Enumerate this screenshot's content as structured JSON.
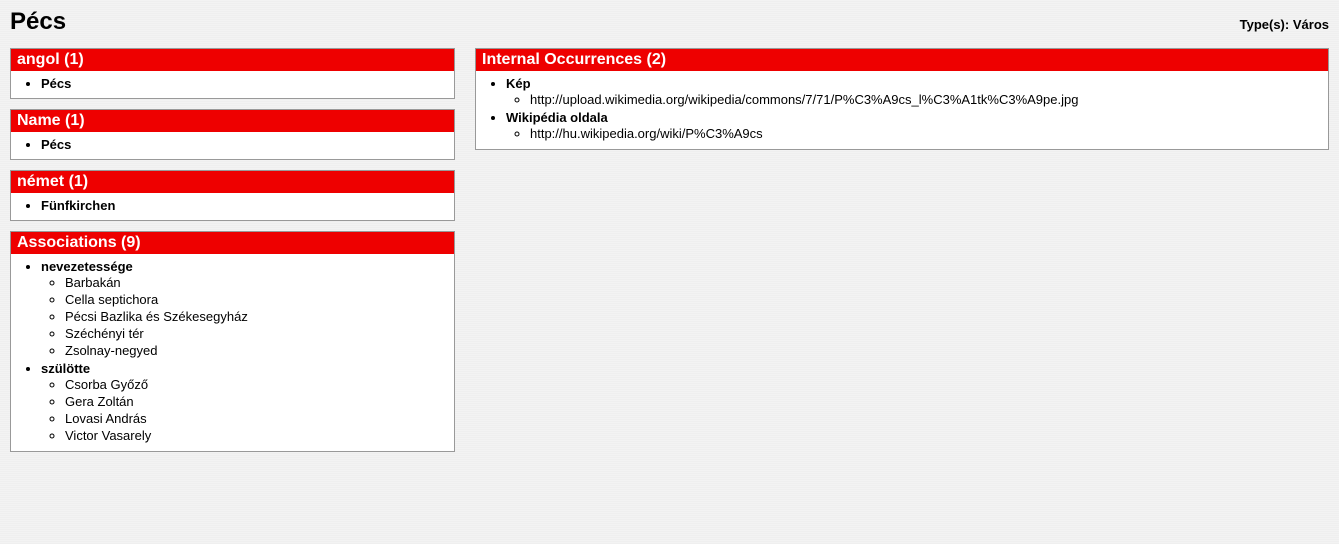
{
  "header": {
    "title": "Pécs",
    "type_label": "Type(s):",
    "type_value": "Város"
  },
  "left_boxes": [
    {
      "title": "angol (1)",
      "items": [
        {
          "label": "Pécs"
        }
      ]
    },
    {
      "title": "Name (1)",
      "items": [
        {
          "label": "Pécs"
        }
      ]
    },
    {
      "title": "német (1)",
      "items": [
        {
          "label": "Fünfkirchen"
        }
      ]
    },
    {
      "title": "Associations (9)",
      "items": [
        {
          "label": "nevezetessége",
          "children": [
            "Barbakán",
            "Cella septichora",
            "Pécsi Bazlika és Székesegyház",
            "Széchényi tér",
            "Zsolnay-negyed"
          ]
        },
        {
          "label": "szülötte",
          "children": [
            "Csorba Győző",
            "Gera Zoltán",
            "Lovasi András",
            "Victor Vasarely"
          ]
        }
      ]
    }
  ],
  "right_boxes": [
    {
      "title": "Internal Occurrences (2)",
      "items": [
        {
          "label": "Kép",
          "children": [
            "http://upload.wikimedia.org/wikipedia/commons/7/71/P%C3%A9cs_l%C3%A1tk%C3%A9pe.jpg"
          ]
        },
        {
          "label": "Wikipédia oldala",
          "children": [
            "http://hu.wikipedia.org/wiki/P%C3%A9cs"
          ]
        }
      ]
    }
  ]
}
